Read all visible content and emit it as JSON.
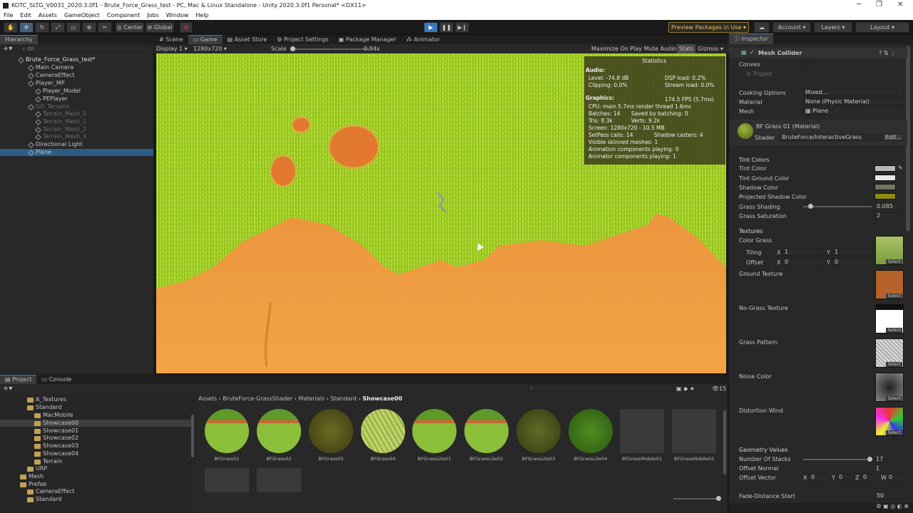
{
  "window": {
    "title": "KOTC_SLTG_V0031_2020.3.0f1 - Brute_Force_Grass_test - PC, Mac & Linux Standalone - Unity 2020.3.0f1 Personal* <DX11>"
  },
  "menu": [
    "File",
    "Edit",
    "Assets",
    "GameObject",
    "Component",
    "Jobs",
    "Window",
    "Help"
  ],
  "toolbar": {
    "center": "Center",
    "global": "Global",
    "preview": "Preview Packages in Use",
    "account": "Account",
    "layers": "Layers",
    "layout": "Layout"
  },
  "hierarchy": {
    "tab": "Hierarchy",
    "search": "All",
    "items": [
      {
        "label": "Brute_Force_Grass_test*",
        "dim": false,
        "scene": true
      },
      {
        "label": "Main Camera",
        "dim": false
      },
      {
        "label": "CameraEffect",
        "dim": false
      },
      {
        "label": "Player_MP",
        "dim": false
      },
      {
        "label": "Player_Model",
        "dim": false
      },
      {
        "label": "PEPlayer",
        "dim": false
      },
      {
        "label": "GO_Terrains",
        "dim": true
      },
      {
        "label": "Terrain_Mesh_0",
        "dim": true
      },
      {
        "label": "Terrain_Mesh_1",
        "dim": true
      },
      {
        "label": "Terrain_Mesh_2",
        "dim": true
      },
      {
        "label": "Terrain_Mesh_3",
        "dim": true
      },
      {
        "label": "Directional Light",
        "dim": false
      },
      {
        "label": "Plane",
        "dim": false
      }
    ]
  },
  "center_tabs": [
    "Scene",
    "Game",
    "Asset Store",
    "Project Settings",
    "Package Manager",
    "Animator"
  ],
  "game": {
    "display": "Display 1",
    "resolution": "1280x720",
    "scale_label": "Scale",
    "scale_value": "0.94x",
    "maximize": "Maximize On Play",
    "mute": "Mute Audio",
    "stats": "Stats",
    "gizmos": "Gizmos"
  },
  "stats": {
    "title": "Statistics",
    "audio": "Audio:",
    "level": "Level: -74.8 dB",
    "clipping": "Clipping: 0.0%",
    "dsp": "DSP load: 0.2%",
    "stream": "Stream load: 0.0%",
    "graphics": "Graphics:",
    "fps": "174.5 FPS (5.7ms)",
    "cpu": "CPU: main 5.7ms  render thread 1.6ms",
    "batches": "Batches: 14",
    "saved": "Saved by batching: 0",
    "tris": "Tris: 8.3k",
    "verts": "Verts: 9.2k",
    "screen": "Screen: 1280x720 - 10.5 MB",
    "setpass": "SetPass calls: 14",
    "shadow": "Shadow casters: 4",
    "skinned": "Visible skinned meshes: 1",
    "anim": "Animation components playing: 0",
    "animator": "Animator components playing: 1"
  },
  "inspector": {
    "tab": "Inspector",
    "component": "Mesh Collider",
    "convex": "Convex",
    "trigger": "Is Trigger",
    "cooking": "Cooking Options",
    "cooking_val": "Mixed...",
    "material": "Material",
    "material_val": "None (Physic Material)",
    "mesh": "Mesh",
    "mesh_val": "Plane",
    "mat_name": "BF Grass 01 (Material)",
    "shader": "Shader",
    "shader_val": "BruteForce/InteractiveGrass",
    "edit": "Edit...",
    "tint_colors": "Tint Colors",
    "tint": "Tint Color",
    "tint_ground": "Tint Ground Color",
    "shadow_color": "Shadow Color",
    "proj_shadow": "Projected Shadow Color",
    "grass_shading": "Grass Shading",
    "grass_shading_val": "0.085",
    "grass_saturation": "Grass Saturation",
    "grass_saturation_val": "2",
    "textures": "Textures",
    "color_grass": "Color Grass",
    "tiling": "Tiling",
    "offset": "Offset",
    "x": "X",
    "y": "Y",
    "z": "Z",
    "w": "W",
    "one": "1",
    "zero": "0",
    "ground_texture": "Ground Texture",
    "no_grass": "No-Grass Texture",
    "grass_pattern": "Grass Pattern",
    "noise_color": "Noise Color",
    "distortion": "Distortion Wind",
    "select": "Select",
    "geometry": "Geometry Values",
    "stacks": "Number Of Stacks",
    "stacks_val": "17",
    "offset_normal": "Offset Normal",
    "offset_normal_val": "1",
    "offset_vector": "Offset Vector",
    "fade": "Fade-Distance Start",
    "fade_val": "50"
  },
  "project": {
    "tab": "Project",
    "console": "Console",
    "breadcrumb": [
      "Assets",
      "BruteForce-GrassShader",
      "Materials",
      "Standard",
      "Showcase00"
    ],
    "count": "15",
    "tree": [
      "A_Textures",
      "Standard",
      "MacMobile",
      "Showcase00",
      "Showcase01",
      "Showcase02",
      "Showcase03",
      "Showcase04",
      "Terrain",
      "URP",
      "Mesh",
      "Prefab",
      "CameraEffect",
      "Standard"
    ],
    "assets": [
      "BFGrass01",
      "BFGrass02",
      "BFGrass03",
      "BFGrass04",
      "BFGrassLite01",
      "BFGrassLite02",
      "BFGrassLite03",
      "BFGrassLite04",
      "BFGrassMobile01",
      "BFGrassMobile02"
    ]
  }
}
